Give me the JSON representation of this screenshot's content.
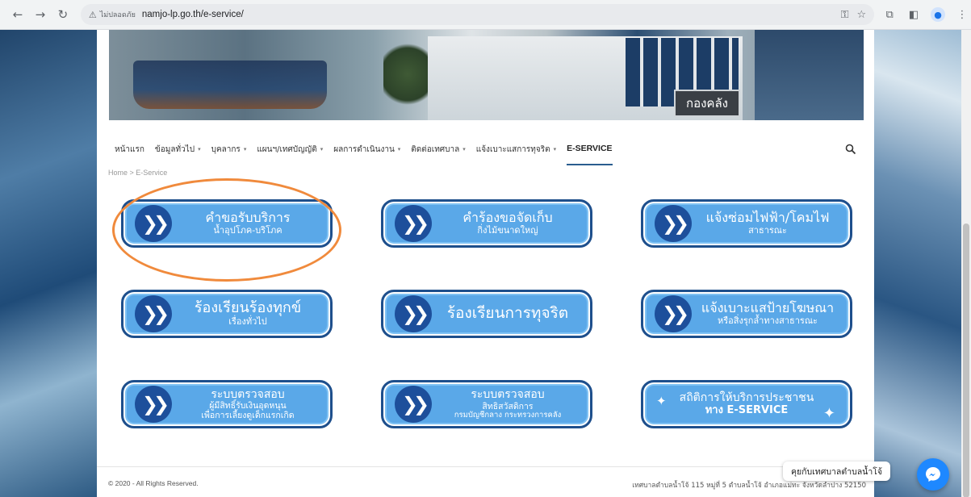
{
  "browser": {
    "back_icon": "arrow-left-icon",
    "forward_icon": "arrow-right-icon",
    "reload_icon": "reload-icon",
    "insecure_label": "ไม่ปลอดภัย",
    "url": "namjo-lp.go.th/e-service/"
  },
  "banner": {
    "sign_text": "กองคลัง"
  },
  "menu": {
    "items": [
      {
        "label": "หน้าแรก"
      },
      {
        "label": "ข้อมูลทั่วไป"
      },
      {
        "label": "บุคลากร"
      },
      {
        "label": "แผนฯ/เทศบัญญัติ"
      },
      {
        "label": "ผลการดำเนินงาน"
      },
      {
        "label": "ติดต่อเทศบาล"
      },
      {
        "label": "แจ้งเบาะแสการทุจริต"
      },
      {
        "label": "E-SERVICE"
      }
    ],
    "active_index": 7
  },
  "breadcrumb": "Home  >  E-Service",
  "services": [
    {
      "title": "คำขอรับบริการ",
      "subtitle": "น้ำอุปโภค-บริโภค"
    },
    {
      "title": "คำร้องขอจัดเก็บ",
      "subtitle": "กิ่งไม้ขนาดใหญ่"
    },
    {
      "title": "แจ้งซ่อมไฟฟ้า/โคมไฟ",
      "subtitle": "สาธารณะ"
    },
    {
      "title": "ร้องเรียนร้องทุกข์",
      "subtitle": "เรื่องทั่วไป"
    },
    {
      "title": "ร้องเรียนการทุจริต",
      "subtitle": ""
    },
    {
      "title": "แจ้งเบาะแสป้ายโฆษณา",
      "subtitle": "หรือสิ่งรุกล้ำทางสาธารณะ"
    },
    {
      "title": "ระบบตรวจสอบ",
      "subtitle": "ผู้มีสิทธิ์รับเงินอุดหนุน",
      "subtitle2": "เพื่อการเลี้ยงดูเด็กแรกเกิด"
    },
    {
      "title": "ระบบตรวจสอบ",
      "subtitle": "สิทธิสวัสดิการ",
      "subtitle2": "กรมบัญชีกลาง กระทรวงการคลัง"
    },
    {
      "title": "สถิติการให้บริการประชาชน",
      "subtitle": "ทาง E-SERVICE"
    }
  ],
  "footer": {
    "copyright": "© 2020 - All Rights Reserved.",
    "address": "เทศบาลตำบลน้ำโจ้ 115 หมู่ที่ 5 ตำบลน้ำโจ้ อำเภอแม่ทะ จังหวัดลำปาง 52150"
  },
  "chat": {
    "label": "คุยกับเทศบาลตำบลน้ำโจ้"
  },
  "colors": {
    "button_fill": "#5aa8e8",
    "button_border": "#1e4f8c",
    "highlight": "#f08a3c"
  }
}
